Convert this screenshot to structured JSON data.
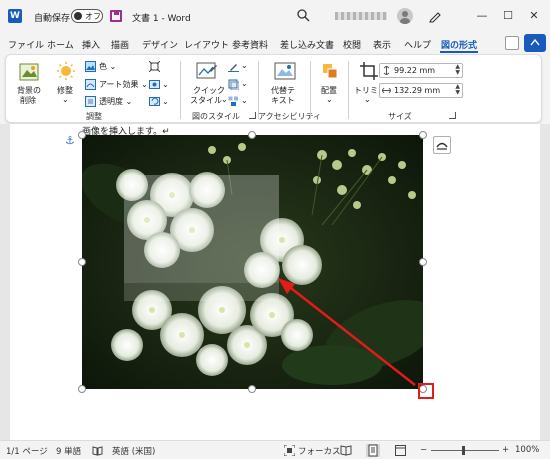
{
  "titlebar": {
    "app_logo": "W",
    "autosave_label": "自動保存",
    "autosave_state": "オフ",
    "document_title": "文書 1  -  Word",
    "icons": [
      "save-icon",
      "search-icon",
      "avatar",
      "pen-icon",
      "minimize-icon",
      "maximize-icon",
      "close-icon"
    ],
    "window_controls": [
      "—",
      "☐",
      "✕"
    ]
  },
  "tabs": [
    {
      "label": "ファイル"
    },
    {
      "label": "ホーム"
    },
    {
      "label": "挿入"
    },
    {
      "label": "描画"
    },
    {
      "label": "デザイン"
    },
    {
      "label": "レイアウト"
    },
    {
      "label": "参考資料"
    },
    {
      "label": "差し込み文書"
    },
    {
      "label": "校閲"
    },
    {
      "label": "表示"
    },
    {
      "label": "ヘルプ"
    },
    {
      "label": "図の形式",
      "active": true
    }
  ],
  "ribbon": {
    "remove_bg": {
      "line1": "背景の",
      "line2": "削除"
    },
    "corrections": "修整",
    "color": "色",
    "art_effects": "アート効果",
    "transparency": "透明度",
    "quick_styles": {
      "line1": "クイック",
      "line2": "スタイル"
    },
    "alt_text": {
      "line1": "代替テ",
      "line2": "キスト"
    },
    "arrange": "配置",
    "crop": "トリミング",
    "height": "99.22 mm",
    "width": "132.29 mm",
    "groups": {
      "adjust": "調整",
      "picture_styles": "図のスタイル",
      "accessibility": "アクセシビリティ",
      "size": "サイズ"
    }
  },
  "document": {
    "text": "画像を挿入します。↵"
  },
  "statusbar": {
    "page": "1/1 ページ",
    "words": "9 単語",
    "language": "英語 (米国)",
    "focus": "フォーカス",
    "zoom_minus": "−",
    "zoom_plus": "+",
    "zoom_level": "100%",
    "zoom_value": 100
  },
  "colors": {
    "accent": "#185abd",
    "annotation": "#e21b1b"
  }
}
